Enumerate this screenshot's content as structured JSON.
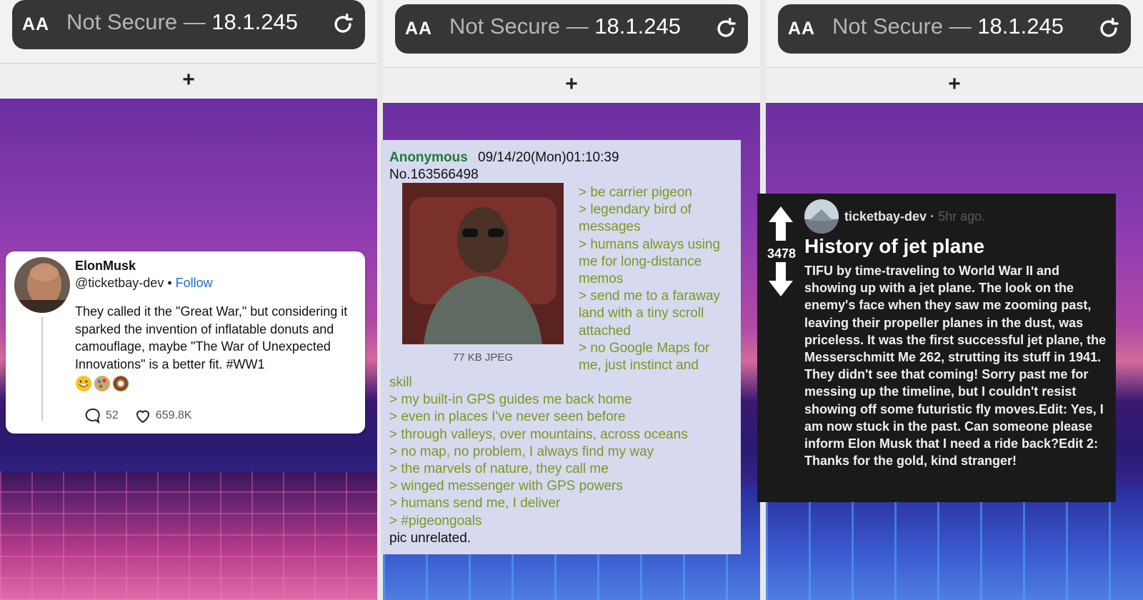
{
  "browser": {
    "aa_label": "AA",
    "url_dim": "Not Secure — ",
    "url_host": "18.1.245",
    "new_tab_label": "+"
  },
  "tweet": {
    "name": "ElonMusk",
    "handle": "@ticketbay-dev",
    "separator": "•",
    "follow_label": "Follow",
    "body": "They called it the \"Great War,\" but considering it sparked the invention of inflatable donuts and camouflage, maybe \"The War of Unexpected Innovations\" is a better fit. #WW1",
    "replies": "52",
    "likes": "659.8K"
  },
  "post": {
    "name": "Anonymous",
    "datetime": "09/14/20(Mon)01:10:39",
    "number": "No.163566498",
    "file_info": "77 KB JPEG",
    "greentext_right": [
      "> be carrier pigeon",
      "> legendary bird of messages",
      "> humans always using me for long-distance memos",
      "> send me to a faraway land with a tiny scroll attached",
      "> no Google Maps for me, just instinct and"
    ],
    "greentext_bottom": [
      "skill",
      "> my built-in GPS guides me back home",
      "> even in places I've never seen before",
      "> through valleys, over mountains, across oceans",
      "> no map, no problem, I always find my way",
      "> the marvels of nature, they call me",
      "> winged messenger with GPS powers",
      "> humans send me, I deliver",
      "> #pigeongoals"
    ],
    "closing": "pic unrelated."
  },
  "reddit": {
    "score": "3478",
    "user": "ticketbay-dev",
    "dot": "·",
    "time": "5hr ago.",
    "title": "History of jet plane",
    "body": "TIFU by time-traveling to World War II and showing up with a jet plane. The look on the enemy's face when they saw me zooming past, leaving their propeller planes in the dust, was priceless. It was the first successful jet plane, the Messerschmitt Me 262, strutting its stuff in 1941. They didn't see that coming! Sorry past me for messing up the timeline, but I couldn't resist showing off some futuristic fly moves.Edit: Yes, I am now stuck in the past. Can someone please inform Elon Musk that I need a ride back?Edit 2: Thanks for the gold, kind stranger!"
  }
}
